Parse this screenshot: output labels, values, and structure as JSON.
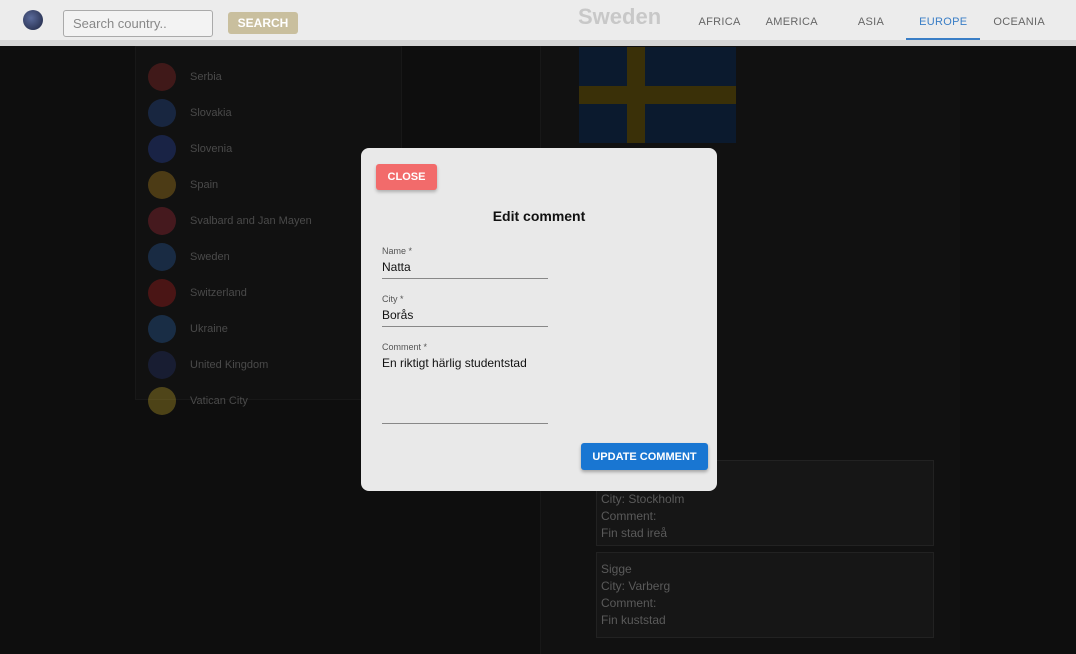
{
  "header": {
    "search_placeholder": "Search country..",
    "search_label": "SEARCH",
    "tabs": [
      {
        "label": "AFRICA"
      },
      {
        "label": "AMERICA"
      },
      {
        "label": "ASIA"
      },
      {
        "label": "EUROPE"
      },
      {
        "label": "OCEANIA"
      }
    ],
    "active_tab": "EUROPE"
  },
  "country_list": [
    {
      "name": "Serbia",
      "color": "#b03030"
    },
    {
      "name": "Slovakia",
      "color": "#2a5bb0"
    },
    {
      "name": "Slovenia",
      "color": "#3050c0"
    },
    {
      "name": "Spain",
      "color": "#d8a020"
    },
    {
      "name": "Svalbard and Jan Mayen",
      "color": "#c03040"
    },
    {
      "name": "Sweden",
      "color": "#2f6ab8"
    },
    {
      "name": "Switzerland",
      "color": "#d02020"
    },
    {
      "name": "Ukraine",
      "color": "#2f6fc0"
    },
    {
      "name": "United Kingdom",
      "color": "#2a3a80"
    },
    {
      "name": "Vatican City",
      "color": "#e0c030"
    }
  ],
  "detail": {
    "country": "Sweden",
    "comments": [
      {
        "city": "City: Stockholm",
        "comment_label": "Comment:",
        "comment": "Fin stad ireå"
      },
      {
        "name": "Sigge",
        "city": "City: Varberg",
        "comment_label": "Comment:",
        "comment": "Fin kuststad"
      }
    ]
  },
  "modal": {
    "close_label": "CLOSE",
    "title": "Edit comment",
    "name_label": "Name *",
    "name_value": "Natta",
    "city_label": "City *",
    "city_value": "Borås",
    "comment_label": "Comment *",
    "comment_value": "En riktigt härlig studentstad",
    "update_label": "UPDATE COMMENT"
  },
  "colors": {
    "close": "#f26b6b",
    "update": "#1976d2",
    "active_tab": "#3a7ec6",
    "search_button": "#c9bf9e"
  }
}
